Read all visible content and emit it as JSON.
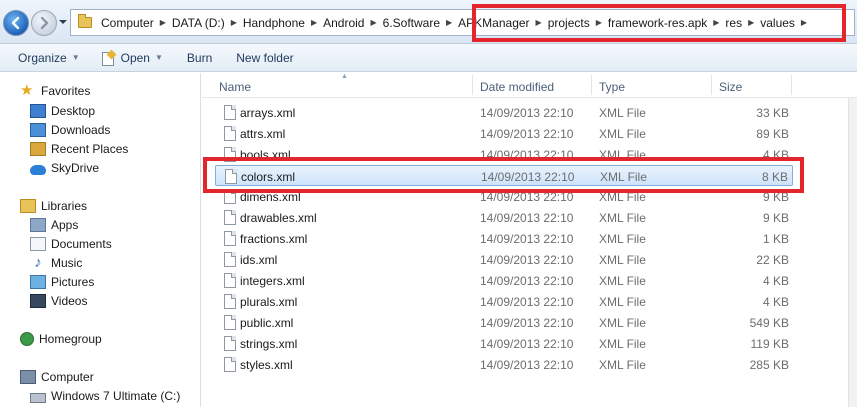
{
  "address_bar": {
    "crumbs": [
      "Computer",
      "DATA (D:)",
      "Handphone",
      "Android",
      "6.Software",
      "APKManager",
      "projects",
      "framework-res.apk",
      "res",
      "values"
    ]
  },
  "toolbar": {
    "organize_label": "Organize",
    "open_label": "Open",
    "burn_label": "Burn",
    "new_folder_label": "New folder"
  },
  "nav": {
    "favorites_label": "Favorites",
    "desktop_label": "Desktop",
    "downloads_label": "Downloads",
    "recent_places_label": "Recent Places",
    "skydrive_label": "SkyDrive",
    "libraries_label": "Libraries",
    "apps_label": "Apps",
    "documents_label": "Documents",
    "music_label": "Music",
    "pictures_label": "Pictures",
    "videos_label": "Videos",
    "homegroup_label": "Homegroup",
    "computer_label": "Computer",
    "windows7_label": "Windows 7 Ultimate (C:)"
  },
  "columns": {
    "name": "Name",
    "date_modified": "Date modified",
    "type": "Type",
    "size": "Size"
  },
  "files": [
    {
      "name": "arrays.xml",
      "date": "14/09/2013 22:10",
      "type": "XML File",
      "size": "33 KB"
    },
    {
      "name": "attrs.xml",
      "date": "14/09/2013 22:10",
      "type": "XML File",
      "size": "89 KB"
    },
    {
      "name": "bools.xml",
      "date": "14/09/2013 22:10",
      "type": "XML File",
      "size": "4 KB"
    },
    {
      "name": "colors.xml",
      "date": "14/09/2013 22:10",
      "type": "XML File",
      "size": "8 KB"
    },
    {
      "name": "dimens.xml",
      "date": "14/09/2013 22:10",
      "type": "XML File",
      "size": "9 KB"
    },
    {
      "name": "drawables.xml",
      "date": "14/09/2013 22:10",
      "type": "XML File",
      "size": "9 KB"
    },
    {
      "name": "fractions.xml",
      "date": "14/09/2013 22:10",
      "type": "XML File",
      "size": "1 KB"
    },
    {
      "name": "ids.xml",
      "date": "14/09/2013 22:10",
      "type": "XML File",
      "size": "22 KB"
    },
    {
      "name": "integers.xml",
      "date": "14/09/2013 22:10",
      "type": "XML File",
      "size": "4 KB"
    },
    {
      "name": "plurals.xml",
      "date": "14/09/2013 22:10",
      "type": "XML File",
      "size": "4 KB"
    },
    {
      "name": "public.xml",
      "date": "14/09/2013 22:10",
      "type": "XML File",
      "size": "549 KB"
    },
    {
      "name": "strings.xml",
      "date": "14/09/2013 22:10",
      "type": "XML File",
      "size": "119 KB"
    },
    {
      "name": "styles.xml",
      "date": "14/09/2013 22:10",
      "type": "XML File",
      "size": "285 KB"
    }
  ],
  "selected_file": "colors.xml",
  "colors": {
    "highlight": "#e3262c",
    "selection": "#cde3fb"
  }
}
